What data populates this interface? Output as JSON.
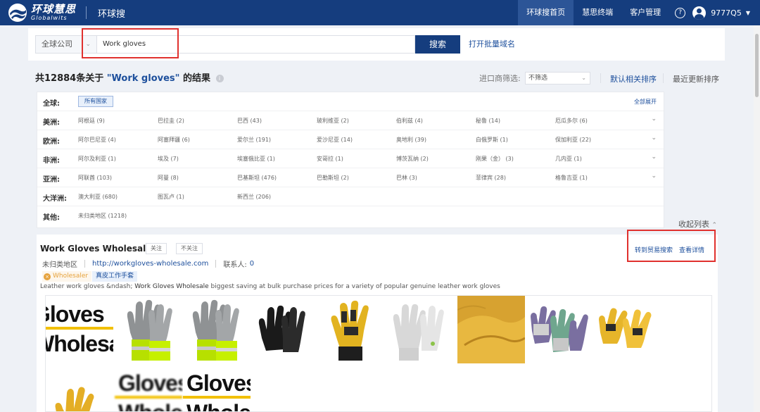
{
  "app": {
    "logo_cn": "环球慧思",
    "logo_en": "Globalwits",
    "title": "环球搜"
  },
  "nav": {
    "items": [
      "环球搜首页",
      "慧思终端",
      "客户管理"
    ],
    "help_icon": "?",
    "username": "9777Q5"
  },
  "search": {
    "scope": "全球公司",
    "query": "Work gloves",
    "button": "搜索",
    "batch_link": "打开批量域名"
  },
  "results": {
    "prefix": "共12884条关于",
    "query": "\"Work gloves\"",
    "suffix": "的结果",
    "importer_label": "进口商筛选:",
    "importer_value": "不筛选",
    "sort_default": "默认相关排序",
    "sort_recent": "最近更新排序"
  },
  "filters": {
    "global_label": "全球:",
    "all_countries": "所有国家",
    "expand_all": "全部展开",
    "collapse": "收起列表",
    "rows": [
      {
        "label": "美洲:",
        "items": [
          "阿根廷 (9)",
          "巴拉圭 (2)",
          "巴西 (43)",
          "玻利维亚 (2)",
          "伯利兹 (4)",
          "秘鲁 (14)",
          "厄瓜多尔 (6)"
        ]
      },
      {
        "label": "欧洲:",
        "items": [
          "阿尔巴尼亚 (4)",
          "阿塞拜疆 (6)",
          "爱尔兰 (191)",
          "爱沙尼亚 (14)",
          "奥地利 (39)",
          "白俄罗斯 (1)",
          "保加利亚 (22)"
        ]
      },
      {
        "label": "非洲:",
        "items": [
          "阿尔及利亚 (1)",
          "埃及 (7)",
          "埃塞俄比亚 (1)",
          "安哥拉 (1)",
          "博茨瓦纳 (2)",
          "刚果（金） (3)",
          "几内亚 (1)"
        ]
      },
      {
        "label": "亚洲:",
        "items": [
          "阿联酋 (103)",
          "阿曼 (8)",
          "巴基斯坦 (476)",
          "巴勒斯坦 (2)",
          "巴林 (3)",
          "菲律宾 (28)",
          "格鲁吉亚 (1)"
        ]
      },
      {
        "label": "大洋洲:",
        "items": [
          "澳大利亚 (680)",
          "图瓦卢 (1)",
          "新西兰 (206)"
        ]
      },
      {
        "label": "其他:",
        "items": [
          "未归类地区 (1218)"
        ]
      }
    ]
  },
  "company": {
    "name": "Work Gloves Wholesale",
    "follow": "关注",
    "unfollow": "不关注",
    "action_trade": "转到贸易搜索",
    "action_detail": "查看详情",
    "region": "未归类地区",
    "website": "http://workgloves-wholesale.com",
    "contacts_label": "联系人:",
    "contacts_count": "0",
    "badge_wholesaler": "Wholesaler",
    "badge_tag": "真皮工作手套",
    "desc_pre": "Leather work gloves &ndash; ",
    "desc_bold": "Work Gloves Wholesale",
    "desc_post": " biggest saving at bulk purchase prices for a variety of popular genuine leather work gloves",
    "image_text_line1": "Gloves",
    "image_text_line2": "Wholesale"
  },
  "colors": {
    "brand": "#153d7e",
    "link": "#1d4f9c",
    "highlight_border": "#e0312e",
    "wholesaler_badge": "#e6a23c"
  }
}
